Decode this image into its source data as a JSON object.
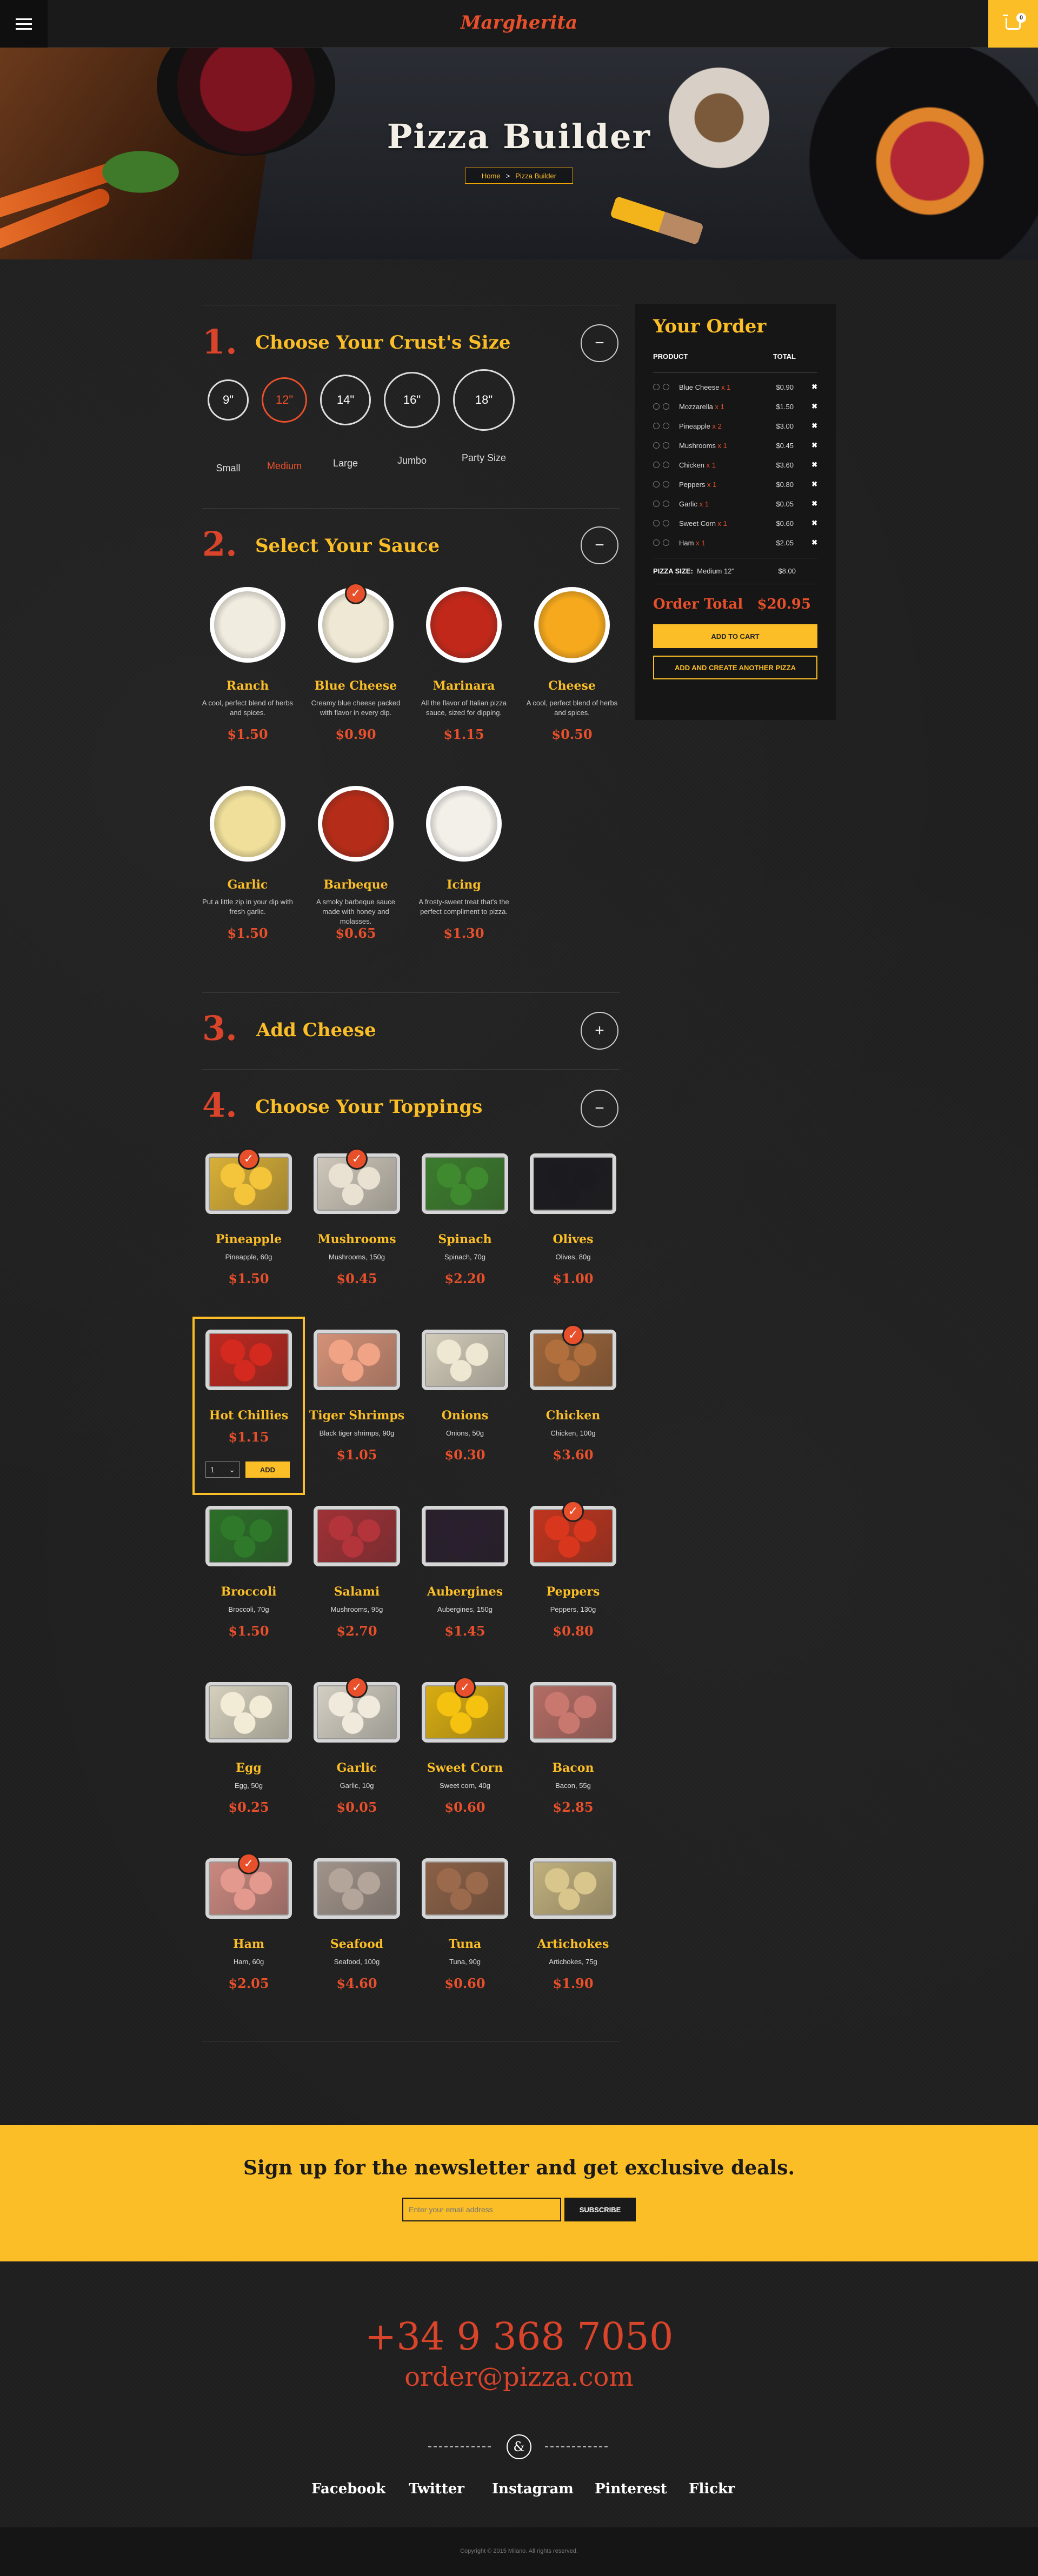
{
  "header": {
    "logo": "Margherita",
    "cart_count": "0"
  },
  "hero": {
    "title": "Pizza Builder",
    "breadcrumb_home": "Home",
    "breadcrumb_sep": ">",
    "breadcrumb_current": "Pizza Builder"
  },
  "steps": {
    "crust": {
      "num": "1.",
      "title": "Choose Your Crust's Size",
      "toggle": "−"
    },
    "sauce": {
      "num": "2.",
      "title": "Select Your Sauce",
      "toggle": "−"
    },
    "cheese": {
      "num": "3.",
      "title": "Add Cheese",
      "toggle": "+"
    },
    "toppings": {
      "num": "4.",
      "title": "Choose Your Toppings",
      "toggle": "−"
    }
  },
  "crusts": [
    {
      "size": "9\"",
      "label": "Small",
      "active": false
    },
    {
      "size": "12\"",
      "label": "Medium",
      "active": true
    },
    {
      "size": "14\"",
      "label": "Large",
      "active": false
    },
    {
      "size": "16\"",
      "label": "Jumbo",
      "active": false
    },
    {
      "size": "18\"",
      "label": "Party Size",
      "active": false
    }
  ],
  "sauces": [
    {
      "name": "Ranch",
      "desc": "A cool, perfect blend of herbs and spices.",
      "price": "$1.50",
      "selected": false,
      "color": "#f1ece0"
    },
    {
      "name": "Blue Cheese",
      "desc": "Creamy blue cheese packed with flavor in every dip.",
      "price": "$0.90",
      "selected": true,
      "color": "#efe8d4"
    },
    {
      "name": "Marinara",
      "desc": "All the flavor of Italian pizza sauce, sized for dipping.",
      "price": "$1.15",
      "selected": false,
      "color": "#c1281a"
    },
    {
      "name": "Cheese",
      "desc": "A cool, perfect blend of herbs and spices.",
      "price": "$0.50",
      "selected": false,
      "color": "#f6a91c"
    },
    {
      "name": "Garlic",
      "desc": "Put a little zip in your dip with fresh garlic.",
      "price": "$1.50",
      "selected": false,
      "color": "#efdf9a"
    },
    {
      "name": "Barbeque",
      "desc": "A smoky barbeque sauce made with honey and molasses.",
      "price": "$0.65",
      "selected": false,
      "color": "#b52c18"
    },
    {
      "name": "Icing",
      "desc": "A frosty-sweet treat that's the perfect compliment to pizza.",
      "price": "$1.30",
      "selected": false,
      "color": "#f3f0ea"
    }
  ],
  "toppings": [
    {
      "name": "Pineapple",
      "desc": "Pineapple, 60g",
      "price": "$1.50",
      "selected": true,
      "color": "#f4c53a"
    },
    {
      "name": "Mushrooms",
      "desc": "Mushrooms, 150g",
      "price": "$0.45",
      "selected": true,
      "color": "#e9e1d2"
    },
    {
      "name": "Spinach",
      "desc": "Spinach, 70g",
      "price": "$2.20",
      "selected": false,
      "color": "#3f8a2f"
    },
    {
      "name": "Olives",
      "desc": "Olives, 80g",
      "price": "$1.00",
      "selected": false,
      "color": "#1a1a1f"
    },
    {
      "name": "Hot Chillies",
      "desc": "",
      "price": "$1.15",
      "selected": false,
      "color": "#d4291f"
    },
    {
      "name": "Tiger Shrimps",
      "desc": "Black tiger shrimps, 90g",
      "price": "$1.05",
      "selected": false,
      "color": "#f0a385"
    },
    {
      "name": "Onions",
      "desc": "Onions, 50g",
      "price": "$0.30",
      "selected": false,
      "color": "#eee7d2"
    },
    {
      "name": "Chicken",
      "desc": "Chicken, 100g",
      "price": "$3.60",
      "selected": true,
      "color": "#b06f3d"
    },
    {
      "name": "Broccoli",
      "desc": "Broccoli, 70g",
      "price": "$1.50",
      "selected": false,
      "color": "#2e7a2a"
    },
    {
      "name": "Salami",
      "desc": "Mushrooms, 95g",
      "price": "$2.70",
      "selected": false,
      "color": "#b3343a"
    },
    {
      "name": "Aubergines",
      "desc": "Aubergines, 150g",
      "price": "$1.45",
      "selected": false,
      "color": "#2a1f2e"
    },
    {
      "name": "Peppers",
      "desc": "Peppers, 130g",
      "price": "$0.80",
      "selected": true,
      "color": "#d8371d"
    },
    {
      "name": "Egg",
      "desc": "Egg, 50g",
      "price": "$0.25",
      "selected": false,
      "color": "#f2ecd6"
    },
    {
      "name": "Garlic",
      "desc": "Garlic, 10g",
      "price": "$0.05",
      "selected": true,
      "color": "#efeadc"
    },
    {
      "name": "Sweet Corn",
      "desc": "Sweet corn, 40g",
      "price": "$0.60",
      "selected": true,
      "color": "#f4c20f"
    },
    {
      "name": "Bacon",
      "desc": "Bacon, 55g",
      "price": "$2.85",
      "selected": false,
      "color": "#c9786f"
    },
    {
      "name": "Ham",
      "desc": "Ham, 60g",
      "price": "$2.05",
      "selected": true,
      "color": "#e4998e"
    },
    {
      "name": "Seafood",
      "desc": "Seafood, 100g",
      "price": "$4.60",
      "selected": false,
      "color": "#b4a59a"
    },
    {
      "name": "Tuna",
      "desc": "Tuna, 90g",
      "price": "$0.60",
      "selected": false,
      "color": "#9b6a4c"
    },
    {
      "name": "Artichokes",
      "desc": "Artichokes, 75g",
      "price": "$1.90",
      "selected": false,
      "color": "#d9c68c"
    }
  ],
  "hot_chillies_controls": {
    "qty": "1",
    "add": "ADD"
  },
  "order": {
    "title": "Your Order",
    "col_product": "PRODUCT",
    "col_total": "TOTAL",
    "items": [
      {
        "name": "Blue Cheese",
        "qty": "x 1",
        "price": "$0.90"
      },
      {
        "name": "Mozzarella",
        "qty": "x 1",
        "price": "$1.50"
      },
      {
        "name": "Pineapple",
        "qty": "x 2",
        "price": "$3.00"
      },
      {
        "name": "Mushrooms",
        "qty": "x 1",
        "price": "$0.45"
      },
      {
        "name": "Chicken",
        "qty": "x 1",
        "price": "$3.60"
      },
      {
        "name": "Peppers",
        "qty": "x 1",
        "price": "$0.80"
      },
      {
        "name": "Garlic",
        "qty": "x 1",
        "price": "$0.05"
      },
      {
        "name": "Sweet Corn",
        "qty": "x 1",
        "price": "$0.60"
      },
      {
        "name": "Ham",
        "qty": "x 1",
        "price": "$2.05"
      }
    ],
    "size_label": "PIZZA SIZE:",
    "size_value": "Medium 12\"",
    "size_price": "$8.00",
    "total_label": "Order Total",
    "total_value": "$20.95",
    "add_to_cart": "ADD TO CART",
    "add_another": "ADD AND CREATE ANOTHER PIZZA"
  },
  "newsletter": {
    "title": "Sign up for the newsletter and get exclusive deals.",
    "placeholder": "Enter your email address",
    "button": "SUBSCRIBE"
  },
  "footer": {
    "phone": "+34 9 368 7050",
    "email": "order@pizza.com",
    "amp": "&",
    "social": [
      "Facebook",
      "Twitter",
      "Instagram",
      "Pinterest",
      "Flickr"
    ],
    "copyright": "Copyright © 2015 Milano. All rights reserved."
  }
}
